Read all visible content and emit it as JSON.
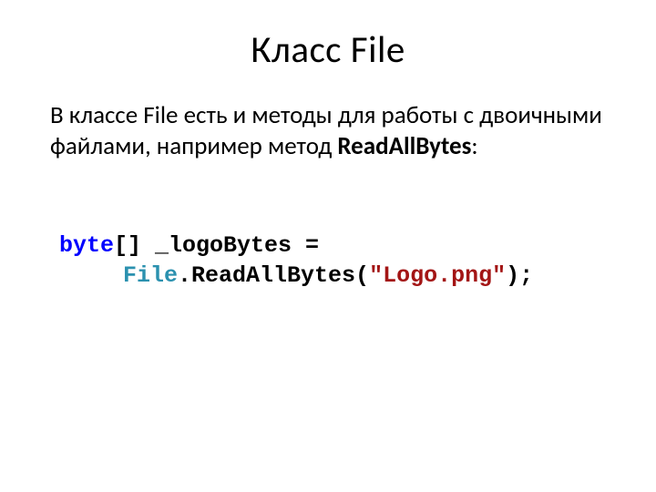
{
  "title": "Класс File",
  "body": {
    "part1": "В классе File есть и методы для работы с двоичными файлами, например метод ",
    "method": "ReadAllBytes",
    "part2": ":"
  },
  "code": {
    "kw_byte": "byte",
    "brackets_decl": "[] _logoBytes =",
    "class_file": "File",
    "call_part": ".ReadAllBytes(",
    "string_lit": "\"Logo.png\"",
    "close": ");"
  }
}
